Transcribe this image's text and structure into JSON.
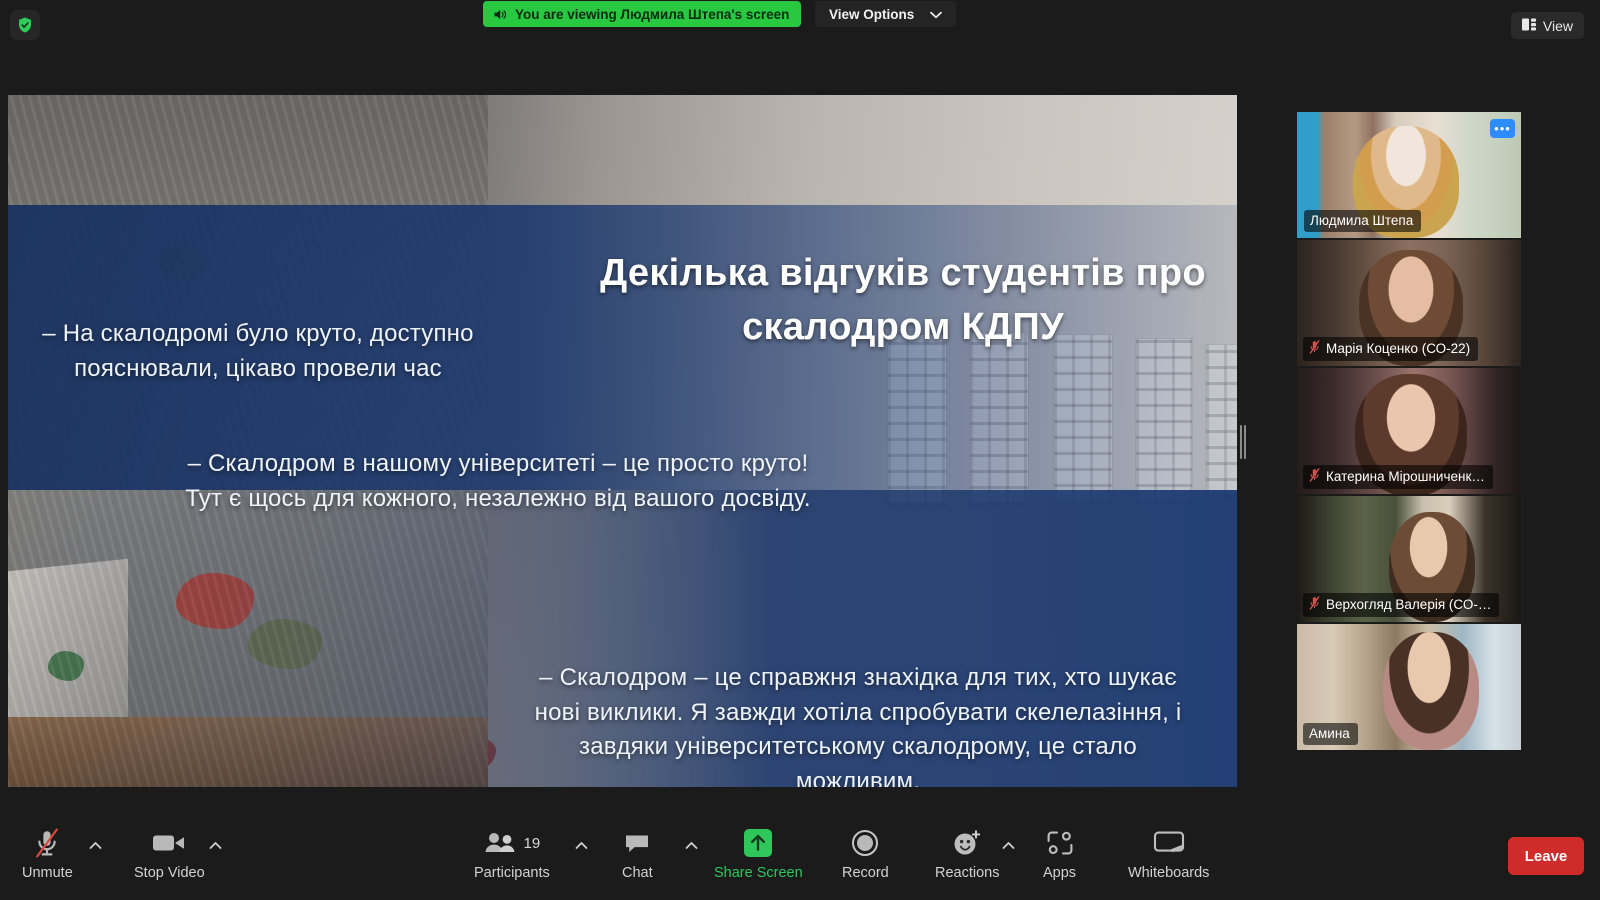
{
  "topbar": {
    "encryption_icon": "shield-check-icon",
    "viewing_banner": "You are viewing Людмила Штепа's screen",
    "speaker_icon": "speaker-icon",
    "view_options_label": "View Options",
    "view_options_caret": "chevron-down-icon",
    "view_button_label": "View",
    "view_button_icon": "layout-grid-icon"
  },
  "shared_screen": {
    "presenter": "Людмила Штепа",
    "slide_title": "Декілька відгуків студентів про скалодром КДПУ",
    "quotes": [
      "– На скалодромі було круто, доступно пояснювали, цікаво провели час",
      "– Скалодром в нашому університеті – це просто круто! Тут є щось для кожного, незалежно від вашого досвіду.",
      "– Скалодром – це справжня знахідка для тих, хто шукає нові виклики. Я завжди хотіла спробувати скелелазіння, і завдяки університетському скалодрому, це стало можливим."
    ],
    "logo_icon": "climber-pictogram-icon",
    "drag_handle": "share-resize-handle"
  },
  "participants_strip": {
    "tiles": [
      {
        "name": "Людмила Штепа",
        "muted": false,
        "active_speaker": true,
        "more_label": "•••"
      },
      {
        "name": "Марія Коценко (СО-22)",
        "muted": true,
        "active_speaker": false
      },
      {
        "name": "Катерина Мірошниченк…",
        "muted": true,
        "active_speaker": false
      },
      {
        "name": "Верхогляд Валерія (СО-…",
        "muted": true,
        "active_speaker": false
      },
      {
        "name": "Амина",
        "muted": false,
        "active_speaker": false
      }
    ],
    "scroll_down_icon": "chevron-down-icon"
  },
  "toolbar": {
    "items": [
      {
        "label": "Unmute",
        "icon": "microphone-muted-icon",
        "caret": true,
        "accent": false
      },
      {
        "label": "Stop Video",
        "icon": "video-camera-icon",
        "caret": true,
        "accent": false
      },
      {
        "label": "Participants",
        "icon": "people-icon",
        "caret": true,
        "accent": false,
        "count": "19"
      },
      {
        "label": "Chat",
        "icon": "chat-bubble-icon",
        "caret": true,
        "accent": false
      },
      {
        "label": "Share Screen",
        "icon": "share-arrow-up-icon",
        "caret": false,
        "accent": true
      },
      {
        "label": "Record",
        "icon": "record-circle-icon",
        "caret": false,
        "accent": false
      },
      {
        "label": "Reactions",
        "icon": "smiley-plus-icon",
        "caret": true,
        "accent": false
      },
      {
        "label": "Apps",
        "icon": "apps-icon",
        "caret": false,
        "accent": false
      },
      {
        "label": "Whiteboards",
        "icon": "whiteboard-icon",
        "caret": false,
        "accent": false
      }
    ],
    "leave_label": "Leave"
  },
  "colors": {
    "accent_green": "#28c840",
    "share_green": "#2fc75c",
    "leave_red": "#d02b2b",
    "active_border": "#ffe14d",
    "more_blue": "#2d8cff",
    "app_bg": "#1b1b1b"
  }
}
